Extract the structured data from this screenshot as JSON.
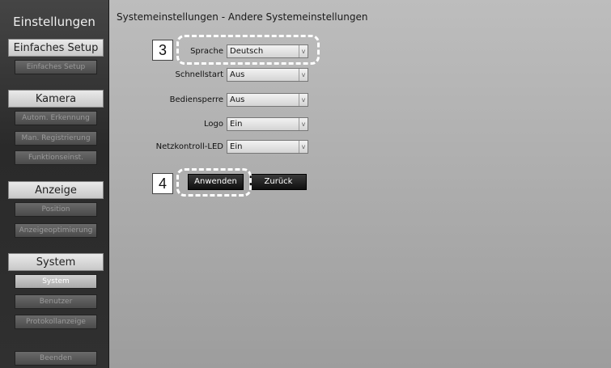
{
  "sidebar": {
    "title": "Einstellungen",
    "sections": [
      {
        "label": "Einfaches Setup",
        "items": [
          {
            "label": "Einfaches Setup"
          }
        ]
      },
      {
        "label": "Kamera",
        "items": [
          {
            "label": "Autom. Erkennung"
          },
          {
            "label": "Man. Registrierung"
          },
          {
            "label": "Funktionseinst."
          }
        ]
      },
      {
        "label": "Anzeige",
        "items": [
          {
            "label": "Position"
          },
          {
            "label": "Anzeigeoptimierung"
          }
        ]
      },
      {
        "label": "System",
        "items": [
          {
            "label": "System"
          },
          {
            "label": "Benutzer"
          },
          {
            "label": "Protokollanzeige"
          }
        ]
      }
    ],
    "exit_label": "Beenden"
  },
  "main": {
    "title": "Systemeinstellungen - Andere Systemeinstellungen",
    "rows": [
      {
        "label": "Sprache",
        "value": "Deutsch"
      },
      {
        "label": "Schnellstart",
        "value": "Aus"
      },
      {
        "label": "Bediensperre",
        "value": "Aus"
      },
      {
        "label": "Logo",
        "value": "Ein"
      },
      {
        "label": "Netzkontroll-LED",
        "value": "Ein"
      }
    ],
    "dropdown_arrow": "v",
    "apply_label": "Anwenden",
    "back_label": "Zurück"
  },
  "annotations": {
    "step3": "3",
    "step4": "4"
  }
}
